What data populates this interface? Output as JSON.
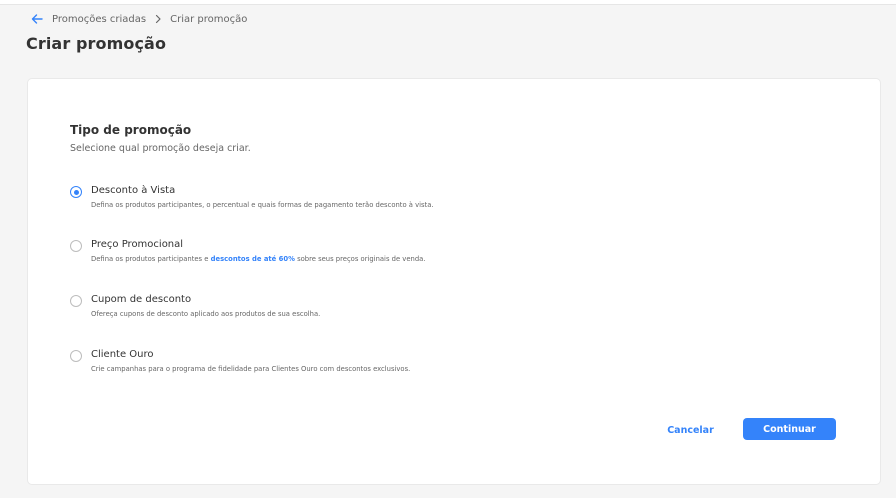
{
  "breadcrumb": {
    "parent": "Promoções criadas",
    "current": "Criar promoção"
  },
  "page_title": "Criar promoção",
  "section": {
    "title": "Tipo de promoção",
    "subtitle": "Selecione qual promoção deseja criar."
  },
  "options": [
    {
      "title": "Desconto à Vista",
      "desc": "Defina os produtos participantes, o percentual e quais formas de pagamento terão desconto à vista.",
      "selected": true
    },
    {
      "title": "Preço Promocional",
      "desc_before": "Defina os produtos participantes e ",
      "desc_highlight": "descontos de até 60%",
      "desc_after": " sobre seus preços originais de venda.",
      "selected": false
    },
    {
      "title": "Cupom de desconto",
      "desc": "Ofereça cupons de desconto aplicado aos produtos de sua escolha.",
      "selected": false
    },
    {
      "title": "Cliente Ouro",
      "desc": "Crie campanhas para o programa de fidelidade para Clientes Ouro com descontos exclusivos.",
      "selected": false
    }
  ],
  "actions": {
    "cancel": "Cancelar",
    "continue": "Continuar"
  },
  "colors": {
    "accent": "#3483fa",
    "background": "#f5f5f5",
    "card": "#ffffff"
  },
  "icons": {
    "back": "arrow-left-icon",
    "separator": "chevron-right-icon"
  }
}
